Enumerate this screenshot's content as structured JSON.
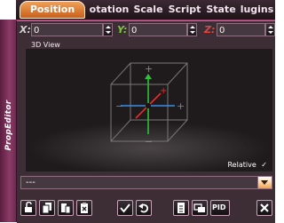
{
  "side_panel": {
    "title": "PropEditor"
  },
  "tabs": [
    {
      "label": "Position",
      "active": true
    },
    {
      "label": "otation",
      "active": false
    },
    {
      "label": "Scale",
      "active": false
    },
    {
      "label": "Script",
      "active": false
    },
    {
      "label": "State",
      "active": false
    },
    {
      "label": "lugins",
      "active": false
    }
  ],
  "coords": {
    "x": {
      "label": "X:",
      "value": "0",
      "color": "#d0d0d0"
    },
    "y": {
      "label": "Y:",
      "value": "0",
      "color": "#7ac83c"
    },
    "z": {
      "label": "Z:",
      "value": "0",
      "color": "#e04444"
    }
  },
  "viewport": {
    "title": "3D View",
    "relative_label": "Relative",
    "relative_checked": true,
    "relative_check": "✓"
  },
  "dropdown": {
    "value": "---"
  },
  "toolbar": {
    "icons": [
      "unlock-icon",
      "copy-icon",
      "paste-icon",
      "clipboard-delete-icon",
      "checkmark-icon",
      "undo-icon",
      "document-icon",
      "snap-icon",
      "pid-icon",
      "close-icon"
    ],
    "pid_label": "PID"
  },
  "colors": {
    "accent": "#e07a2e",
    "panel": "#3d2e36",
    "side": "#7a2f58",
    "axis_x": "#3a8ee6",
    "axis_y": "#2fbf3a",
    "axis_z": "#e03030"
  }
}
